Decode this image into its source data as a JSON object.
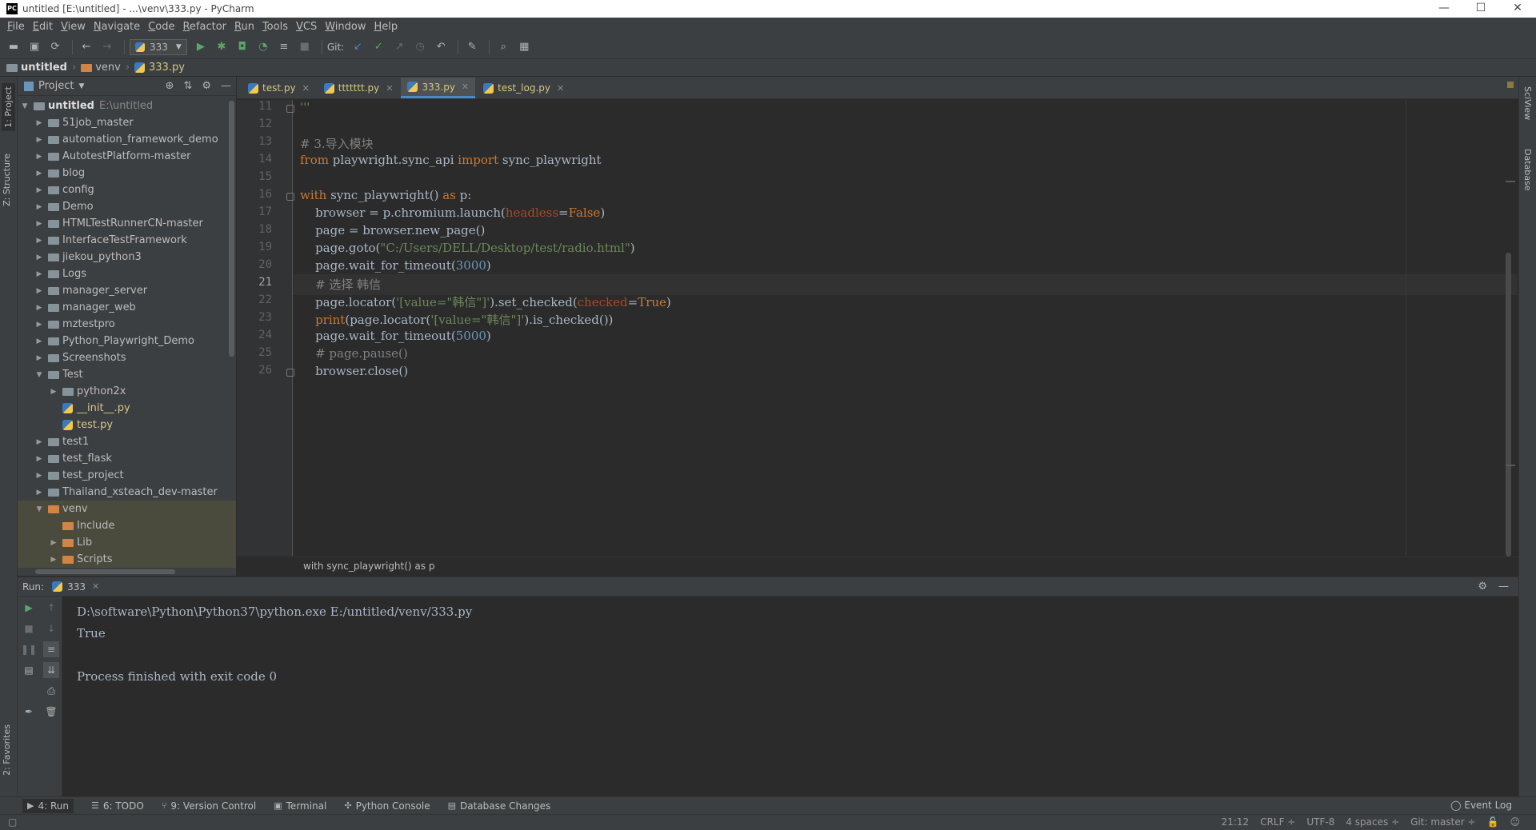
{
  "window": {
    "title": "untitled [E:\\untitled] - ...\\venv\\333.py - PyCharm",
    "logo": "PC",
    "minimize": "—",
    "maximize": "☐",
    "close": "✕"
  },
  "menu": [
    "File",
    "Edit",
    "View",
    "Navigate",
    "Code",
    "Refactor",
    "Run",
    "Tools",
    "VCS",
    "Window",
    "Help"
  ],
  "toolbar": {
    "run_config": "333",
    "git_label": "Git:"
  },
  "breadcrumb": {
    "root": "untitled",
    "folder": "venv",
    "file": "333.py"
  },
  "left_strip": {
    "project_tab": "1: Project",
    "structure_tab": "Z: Structure",
    "favorites_tab": "2: Favorites"
  },
  "right_strip": {
    "sciview_tab": "SciView",
    "database_tab": "Database"
  },
  "project_panel": {
    "header": "Project",
    "root_name": "untitled",
    "root_path": "E:\\untitled",
    "items": [
      {
        "name": "51job_master",
        "kind": "folder",
        "depth": 1,
        "expanded": false
      },
      {
        "name": "automation_framework_demo",
        "kind": "folder",
        "depth": 1,
        "expanded": false
      },
      {
        "name": "AutotestPlatform-master",
        "kind": "folder",
        "depth": 1,
        "expanded": false
      },
      {
        "name": "blog",
        "kind": "folder",
        "depth": 1,
        "expanded": false
      },
      {
        "name": "config",
        "kind": "folder",
        "depth": 1,
        "expanded": false
      },
      {
        "name": "Demo",
        "kind": "folder",
        "depth": 1,
        "expanded": false
      },
      {
        "name": "HTMLTestRunnerCN-master",
        "kind": "folder",
        "depth": 1,
        "expanded": false
      },
      {
        "name": "InterfaceTestFramework",
        "kind": "folder",
        "depth": 1,
        "expanded": false
      },
      {
        "name": "jiekou_python3",
        "kind": "folder",
        "depth": 1,
        "expanded": false
      },
      {
        "name": "Logs",
        "kind": "folder",
        "depth": 1,
        "expanded": false
      },
      {
        "name": "manager_server",
        "kind": "folder",
        "depth": 1,
        "expanded": false
      },
      {
        "name": "manager_web",
        "kind": "folder",
        "depth": 1,
        "expanded": false
      },
      {
        "name": "mztestpro",
        "kind": "folder",
        "depth": 1,
        "expanded": false
      },
      {
        "name": "Python_Playwright_Demo",
        "kind": "folder",
        "depth": 1,
        "expanded": false
      },
      {
        "name": "Screenshots",
        "kind": "folder",
        "depth": 1,
        "expanded": false
      },
      {
        "name": "Test",
        "kind": "folder",
        "depth": 1,
        "expanded": true
      },
      {
        "name": "python2x",
        "kind": "folder",
        "depth": 2,
        "expanded": false
      },
      {
        "name": "__init__.py",
        "kind": "pyfile",
        "depth": 2,
        "color": "#d5c782"
      },
      {
        "name": "test.py",
        "kind": "pyfile",
        "depth": 2,
        "color": "#d5c782"
      },
      {
        "name": "test1",
        "kind": "folder",
        "depth": 1,
        "expanded": false
      },
      {
        "name": "test_flask",
        "kind": "folder",
        "depth": 1,
        "expanded": false
      },
      {
        "name": "test_project",
        "kind": "folder",
        "depth": 1,
        "expanded": false
      },
      {
        "name": "Thailand_xsteach_dev-master",
        "kind": "folder",
        "depth": 1,
        "expanded": false
      },
      {
        "name": "venv",
        "kind": "folder-orange",
        "depth": 1,
        "expanded": true,
        "selected": true
      },
      {
        "name": "Include",
        "kind": "folder-orange",
        "depth": 2,
        "noarrow": true,
        "selected": true
      },
      {
        "name": "Lib",
        "kind": "folder-orange",
        "depth": 2,
        "expanded": false,
        "selected": true
      },
      {
        "name": "Scripts",
        "kind": "folder-orange",
        "depth": 2,
        "expanded": false,
        "selected": true
      }
    ]
  },
  "editor": {
    "tabs": [
      {
        "label": "test.py",
        "active": false
      },
      {
        "label": "ttttttt.py",
        "active": false
      },
      {
        "label": "333.py",
        "active": true
      },
      {
        "label": "test_log.py",
        "active": false
      }
    ],
    "current_line": "21",
    "code_breadcrumb": "with sync_playwright() as p",
    "lines": [
      {
        "n": "11",
        "segs": [
          {
            "t": "'''",
            "c": "str"
          }
        ]
      },
      {
        "n": "12",
        "segs": []
      },
      {
        "n": "13",
        "segs": [
          {
            "t": "# 3.导入模块",
            "c": "cm"
          }
        ]
      },
      {
        "n": "14",
        "segs": [
          {
            "t": "from ",
            "c": "kw"
          },
          {
            "t": "playwright.sync_api ",
            "c": ""
          },
          {
            "t": "import ",
            "c": "kw"
          },
          {
            "t": "sync_playwright",
            "c": ""
          }
        ]
      },
      {
        "n": "15",
        "segs": []
      },
      {
        "n": "16",
        "segs": [
          {
            "t": "with ",
            "c": "kw"
          },
          {
            "t": "sync_playwright() ",
            "c": ""
          },
          {
            "t": "as ",
            "c": "kw"
          },
          {
            "t": "p:",
            "c": ""
          }
        ]
      },
      {
        "n": "17",
        "segs": [
          {
            "t": "    browser = p.chromium.launch(",
            "c": ""
          },
          {
            "t": "headless",
            "c": "param"
          },
          {
            "t": "=",
            "c": ""
          },
          {
            "t": "False",
            "c": "kw"
          },
          {
            "t": ")",
            "c": ""
          }
        ]
      },
      {
        "n": "18",
        "segs": [
          {
            "t": "    page = browser.new_page()",
            "c": ""
          }
        ]
      },
      {
        "n": "19",
        "segs": [
          {
            "t": "    page.goto(",
            "c": ""
          },
          {
            "t": "\"C:/Users/DELL/Desktop/test/radio.html\"",
            "c": "str"
          },
          {
            "t": ")",
            "c": ""
          }
        ]
      },
      {
        "n": "20",
        "segs": [
          {
            "t": "    page.wait_for_timeout(",
            "c": ""
          },
          {
            "t": "3000",
            "c": "num"
          },
          {
            "t": ")",
            "c": ""
          }
        ]
      },
      {
        "n": "21",
        "segs": [
          {
            "t": "    # 选择 韩信",
            "c": "cm"
          }
        ]
      },
      {
        "n": "22",
        "segs": [
          {
            "t": "    page.locator(",
            "c": ""
          },
          {
            "t": "'[value=\"韩信\"]'",
            "c": "str"
          },
          {
            "t": ").set_checked(",
            "c": ""
          },
          {
            "t": "checked",
            "c": "param"
          },
          {
            "t": "=",
            "c": ""
          },
          {
            "t": "True",
            "c": "kw"
          },
          {
            "t": ")",
            "c": ""
          }
        ]
      },
      {
        "n": "23",
        "segs": [
          {
            "t": "    ",
            "c": ""
          },
          {
            "t": "print",
            "c": "kw"
          },
          {
            "t": "(page.locator(",
            "c": ""
          },
          {
            "t": "'[value=\"韩信\"]'",
            "c": "str"
          },
          {
            "t": ").is_checked())",
            "c": ""
          }
        ]
      },
      {
        "n": "24",
        "segs": [
          {
            "t": "    page.wait_for_timeout(",
            "c": ""
          },
          {
            "t": "5000",
            "c": "num"
          },
          {
            "t": ")",
            "c": ""
          }
        ]
      },
      {
        "n": "25",
        "segs": [
          {
            "t": "    # page.pause()",
            "c": "cm"
          }
        ]
      },
      {
        "n": "26",
        "segs": [
          {
            "t": "    browser.close()",
            "c": ""
          }
        ]
      }
    ]
  },
  "run_panel": {
    "label": "Run:",
    "tab": "333",
    "output": [
      "D:\\software\\Python\\Python37\\python.exe E:/untitled/venv/333.py",
      "True",
      "",
      "Process finished with exit code 0"
    ]
  },
  "bottom_tabs": [
    {
      "label": "4: Run",
      "icon": "▶",
      "active": true
    },
    {
      "label": "6: TODO",
      "icon": "☰",
      "active": false
    },
    {
      "label": "9: Version Control",
      "icon": "⑂",
      "active": false
    },
    {
      "label": "Terminal",
      "icon": "▣",
      "active": false
    },
    {
      "label": "Python Console",
      "icon": "✣",
      "active": false
    },
    {
      "label": "Database Changes",
      "icon": "▤",
      "active": false
    }
  ],
  "event_log": "Event Log",
  "status": {
    "position": "21:12",
    "line_sep": "CRLF ÷",
    "encoding": "UTF-8",
    "indent": "4 spaces ÷",
    "git": "Git: master ÷"
  }
}
